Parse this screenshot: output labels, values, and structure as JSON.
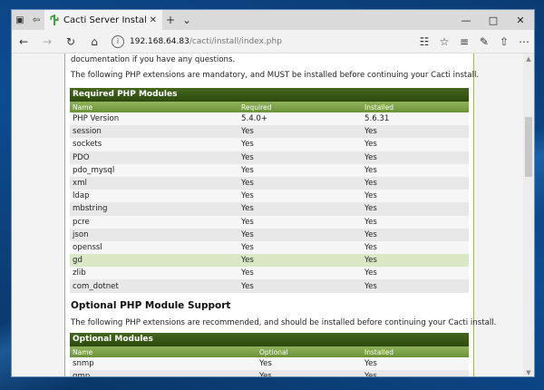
{
  "browser": {
    "tab_title": "Cacti Server Installation",
    "url_host": "192.168.64.83",
    "url_path": "/cacti/install/index.php"
  },
  "page": {
    "intro_partial": "documentation if you have any questions.",
    "required_intro": "The following PHP extensions are mandatory, and MUST be installed before continuing your Cacti install.",
    "required_table": {
      "title": "Required PHP Modules",
      "headers": [
        "Name",
        "Required",
        "Installed"
      ],
      "rows": [
        {
          "name": "PHP Version",
          "required": "5.4.0+",
          "installed": "5.6.31"
        },
        {
          "name": "session",
          "required": "Yes",
          "installed": "Yes"
        },
        {
          "name": "sockets",
          "required": "Yes",
          "installed": "Yes"
        },
        {
          "name": "PDO",
          "required": "Yes",
          "installed": "Yes"
        },
        {
          "name": "pdo_mysql",
          "required": "Yes",
          "installed": "Yes"
        },
        {
          "name": "xml",
          "required": "Yes",
          "installed": "Yes"
        },
        {
          "name": "ldap",
          "required": "Yes",
          "installed": "Yes"
        },
        {
          "name": "mbstring",
          "required": "Yes",
          "installed": "Yes"
        },
        {
          "name": "pcre",
          "required": "Yes",
          "installed": "Yes"
        },
        {
          "name": "json",
          "required": "Yes",
          "installed": "Yes"
        },
        {
          "name": "openssl",
          "required": "Yes",
          "installed": "Yes"
        },
        {
          "name": "gd",
          "required": "Yes",
          "installed": "Yes"
        },
        {
          "name": "zlib",
          "required": "Yes",
          "installed": "Yes"
        },
        {
          "name": "com_dotnet",
          "required": "Yes",
          "installed": "Yes"
        }
      ]
    },
    "optional_heading": "Optional PHP Module Support",
    "optional_intro": "The following PHP extensions are recommended, and should be installed before continuing your Cacti install.",
    "optional_table": {
      "title": "Optional Modules",
      "headers": [
        "Name",
        "Optional",
        "Installed"
      ],
      "rows": [
        {
          "name": "snmp",
          "optional": "Yes",
          "installed": "Yes"
        },
        {
          "name": "gmp",
          "optional": "Yes",
          "installed": "Yes"
        }
      ]
    }
  },
  "colors": {
    "header_dark": "#2c4a0d",
    "header_light": "#6b9238",
    "ok_green": "#2f9a2f"
  }
}
